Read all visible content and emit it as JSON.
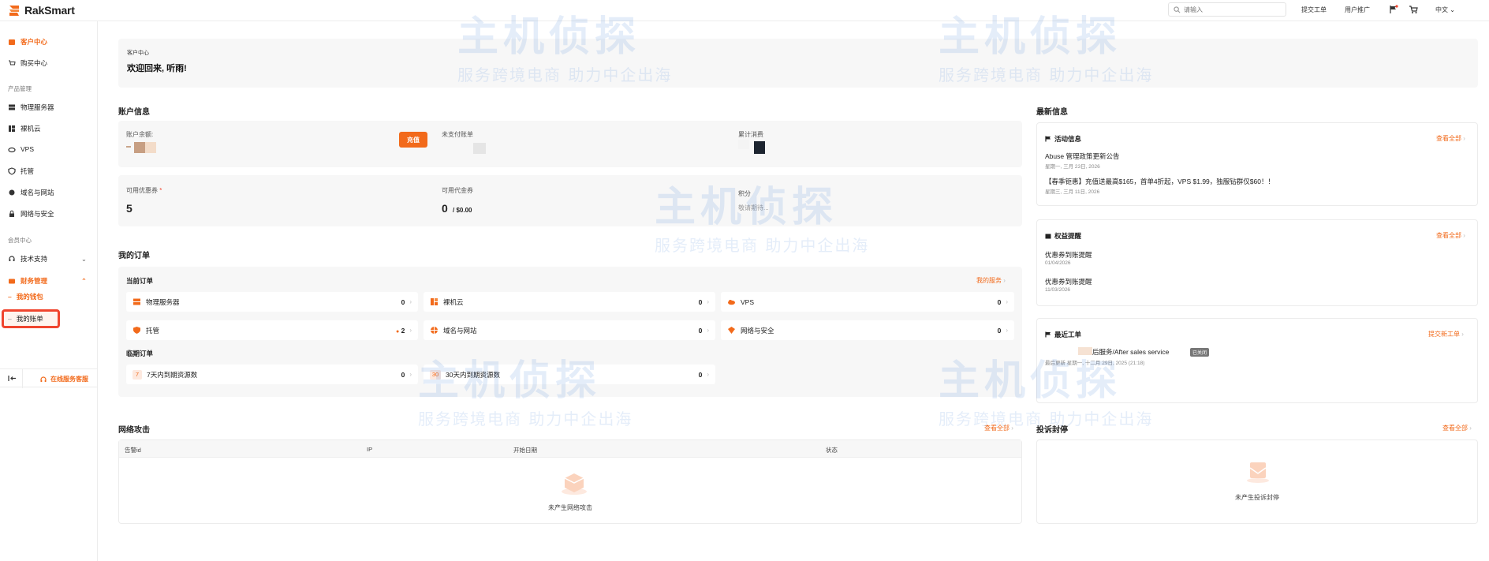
{
  "app": {
    "logo_text": "RakSmart"
  },
  "topbar": {
    "search_placeholder": "请输入",
    "submit_ticket": "提交工单",
    "user_promo": "用户推广",
    "language": "中文"
  },
  "sidebar": {
    "customer_center": "客户中心",
    "purchase_center": "购买中心",
    "product_mgmt_section": "产品管理",
    "physical_server": "物理服务器",
    "bare_metal_cloud": "裸机云",
    "vps": "VPS",
    "hosting": "托管",
    "domain_website": "域名与网站",
    "network_security": "网络与安全",
    "member_center_section": "会员中心",
    "tech_support": "技术支持",
    "finance_mgmt": "财务管理",
    "my_wallet": "我的钱包",
    "my_bills": "我的账单",
    "online_support": "在线服务客服"
  },
  "welcome": {
    "breadcrumb": "客户中心",
    "greeting": "欢迎回来, 听雨!"
  },
  "account": {
    "title": "账户信息",
    "balance_label": "账户余额:",
    "recharge_button": "充值",
    "unpaid_label": "未支付账单",
    "total_spent_label": "累计消费",
    "coupon_label": "可用优惠券",
    "coupon_value": "5",
    "voucher_label": "可用代金券",
    "voucher_value": "0",
    "voucher_amount": "/ $0.00",
    "points_label": "积分",
    "points_value": "敬请期待..."
  },
  "orders": {
    "title": "我的订单",
    "current_title": "当前订单",
    "my_services_link": "我的服务",
    "rows": [
      {
        "label": "物理服务器",
        "count": "0"
      },
      {
        "label": "裸机云",
        "count": "0"
      },
      {
        "label": "VPS",
        "count": "0"
      },
      {
        "label": "托管",
        "count": "2"
      },
      {
        "label": "域名与网站",
        "count": "0"
      },
      {
        "label": "网络与安全",
        "count": "0"
      }
    ],
    "expiring_title": "临期订单",
    "expiring": [
      {
        "badge": "7",
        "label": "7天内到期资源数",
        "count": "0"
      },
      {
        "badge": "30",
        "label": "30天内到期资源数",
        "count": "0"
      }
    ]
  },
  "attacks": {
    "title": "网络攻击",
    "view_all": "查看全部",
    "columns": [
      "告警id",
      "IP",
      "开始日期",
      "状态"
    ],
    "empty": "未产生网络攻击"
  },
  "news": {
    "title": "最新信息",
    "activity": {
      "title": "活动信息",
      "view_all": "查看全部",
      "items": [
        {
          "text": "Abuse 管理政策更新公告",
          "date": "星期一, 三月 23日, 2026"
        },
        {
          "text": "【春季钜惠】充值送最高$165，首单4折起，VPS $1.99，独服钻群仅$60！！",
          "date": "星期三, 三月 11日, 2026"
        }
      ]
    },
    "benefits": {
      "title": "权益提醒",
      "view_all": "查看全部",
      "items": [
        {
          "text": "优惠券到账提醒",
          "date": "01/04/2026"
        },
        {
          "text": "优惠券到账提醒",
          "date": "11/03/2026"
        }
      ]
    },
    "tickets": {
      "title": "最近工单",
      "submit_link": "提交新工单",
      "item_text": "后服务/After sales service",
      "item_badge": "已关闭",
      "item_meta": "最后更新  星期一, 十二月 29日, 2025 (21:18)"
    },
    "complaints": {
      "title": "投诉封停",
      "view_all": "查看全部",
      "empty": "未产生投诉封停"
    }
  },
  "watermark": {
    "big": "主机侦探",
    "small": "服务跨境电商 助力中企出海"
  },
  "colors": {
    "accent": "#f26a1b",
    "highlight": "#f0452e",
    "watermark": "#2a6fd6"
  }
}
